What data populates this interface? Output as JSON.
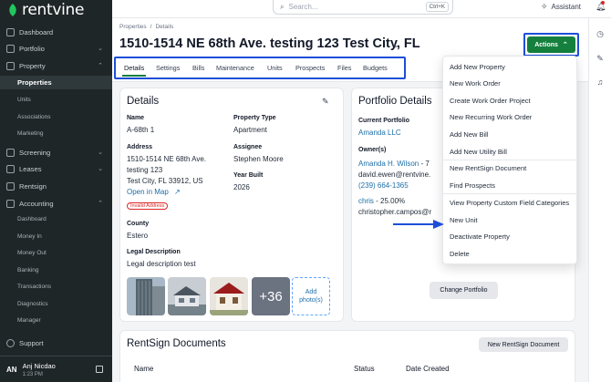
{
  "app": {
    "name": "rentvine"
  },
  "sidebar": {
    "dashboard": "Dashboard",
    "portfolio": "Portfolio",
    "property": "Property",
    "property_sub": [
      "Properties",
      "Units",
      "Associations",
      "Marketing"
    ],
    "screening": "Screening",
    "leases": "Leases",
    "rentsign": "Rentsign",
    "accounting": "Accounting",
    "accounting_sub": [
      "Dashboard",
      "Money In",
      "Money Out",
      "Banking",
      "Transactions",
      "Diagnostics",
      "Manager"
    ],
    "support": "Support",
    "user": {
      "initials": "AN",
      "name": "Anj Nicdao",
      "time": "1:23 PM"
    }
  },
  "topbar": {
    "search_placeholder": "Search...",
    "search_shortcut": "Ctrl+K",
    "assistant": "Assistant"
  },
  "header": {
    "breadcrumb": [
      "Properties",
      "Details"
    ],
    "title": "1510-1514 NE 68th Ave. testing 123 Test City, FL",
    "actions_label": "Actions",
    "tabs": [
      "Details",
      "Settings",
      "Bills",
      "Maintenance",
      "Units",
      "Prospects",
      "Files",
      "Budgets"
    ]
  },
  "details": {
    "title": "Details",
    "name_label": "Name",
    "name_value": "A-68th 1",
    "property_type_label": "Property Type",
    "property_type_value": "Apartment",
    "address_label": "Address",
    "address_line1": "1510-1514 NE 68th Ave.",
    "address_line2": "testing 123",
    "address_line3": "Test City, FL 33912, US",
    "open_in_map": "Open in Map",
    "invalid_address": "Invalid Address",
    "assignee_label": "Assignee",
    "assignee_value": "Stephen Moore",
    "year_built_label": "Year Built",
    "year_built_value": "2026",
    "county_label": "County",
    "county_value": "Estero",
    "legal_label": "Legal Description",
    "legal_value": "Legal description test",
    "more_photos": "+36",
    "add_photo_line1": "Add",
    "add_photo_line2": "photo(s)"
  },
  "portfolio": {
    "title": "Portfolio Details",
    "current_label": "Current Portfolio",
    "current_value": "Amanda LLC",
    "owners_label": "Owner(s)",
    "owner1_name": "Amanda H. Wilson",
    "owner1_pct": " - 7",
    "owner1_email": "david.ewen@rentvine.",
    "owner1_phone": "(239) 664-1365",
    "owner2_name": "chris",
    "owner2_pct": " - 25.00%",
    "owner2_email": "christopher.campos@r",
    "change_button": "Change Portfolio"
  },
  "rentsign": {
    "title": "RentSign Documents",
    "new_button": "New RentSign Document",
    "columns": [
      "Name",
      "Status",
      "Date Created"
    ]
  },
  "actions_menu": {
    "group1": [
      "Add New Property",
      "New Work Order",
      "Create Work Order Project",
      "New Recurring Work Order",
      "Add New Bill",
      "Add New Utility Bill"
    ],
    "group2": [
      "New RentSign Document",
      "Find Prospects"
    ],
    "group3": [
      "View Property Custom Field Categories",
      "New Unit",
      "Deactivate Property",
      "Delete"
    ]
  },
  "colors": {
    "accent_green": "#15803d",
    "highlight_blue": "#1d4ed8",
    "link_blue": "#1d6ea7",
    "sidebar_bg": "#1f2628"
  }
}
